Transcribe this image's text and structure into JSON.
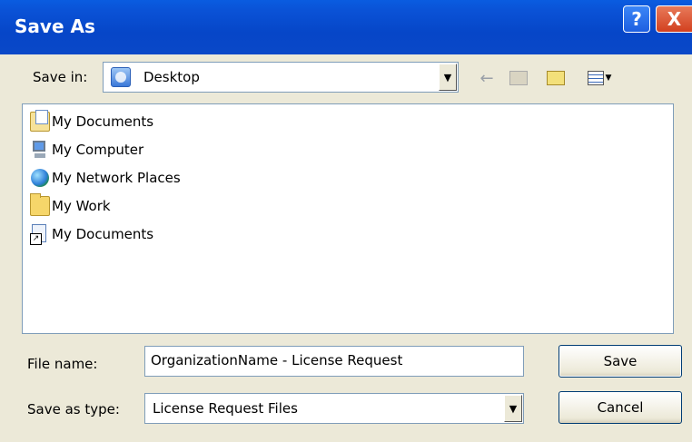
{
  "window": {
    "title": "Save As",
    "help_label": "?",
    "close_label": "X"
  },
  "toolbar": {
    "save_in_label": "Save in:",
    "save_in_value": "Desktop",
    "back_icon": "back-arrow-icon",
    "up_icon": "up-folder-icon",
    "new_folder_icon": "new-folder-icon",
    "views_icon": "views-menu-icon"
  },
  "file_list": [
    {
      "label": "My Documents",
      "icon": "my-documents-icon"
    },
    {
      "label": "My Computer",
      "icon": "my-computer-icon"
    },
    {
      "label": "My Network Places",
      "icon": "network-places-icon"
    },
    {
      "label": "My Work",
      "icon": "folder-icon"
    },
    {
      "label": "My Documents",
      "icon": "shortcut-icon"
    }
  ],
  "form": {
    "file_name_label": "File name:",
    "file_name_value": "OrganizationName - License Request",
    "save_type_label": "Save as type:",
    "save_type_value": "License Request Files"
  },
  "buttons": {
    "save": "Save",
    "cancel": "Cancel"
  }
}
